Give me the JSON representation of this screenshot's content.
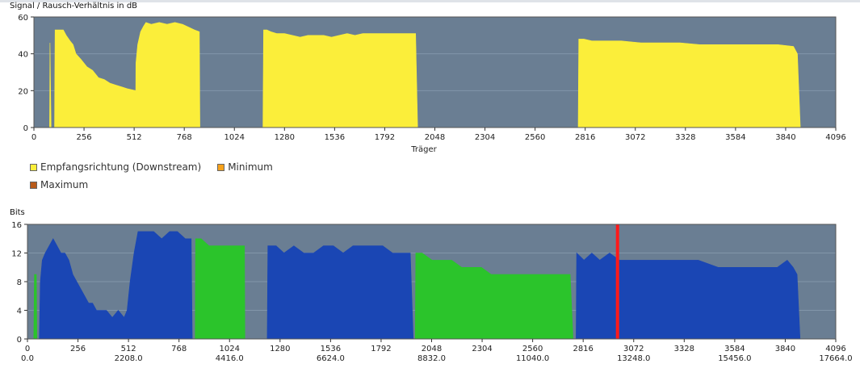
{
  "chart_data": [
    {
      "type": "area",
      "title": "Signal / Rausch-Verhältnis in dB",
      "xlabel": "Träger",
      "ylabel": "",
      "xlim": [
        0,
        4096
      ],
      "ylim": [
        0,
        60
      ],
      "x_ticks": [
        0,
        256,
        512,
        768,
        1024,
        1280,
        1536,
        1792,
        2048,
        2304,
        2560,
        2816,
        3072,
        3328,
        3584,
        3840,
        4096
      ],
      "y_ticks": [
        0,
        20,
        40,
        60
      ],
      "plot_background": "#6a7e93",
      "grid": true,
      "series": [
        {
          "name": "Empfangsrichtung (Downstream)",
          "color": "#fbee3a",
          "points": [
            [
              80,
              0
            ],
            [
              82,
              46
            ],
            [
              88,
              0
            ],
            [
              105,
              0
            ],
            [
              108,
              53
            ],
            [
              150,
              53
            ],
            [
              165,
              50
            ],
            [
              185,
              47
            ],
            [
              200,
              45
            ],
            [
              215,
              40
            ],
            [
              240,
              37
            ],
            [
              270,
              33
            ],
            [
              300,
              31
            ],
            [
              330,
              27
            ],
            [
              360,
              26
            ],
            [
              390,
              24
            ],
            [
              420,
              23
            ],
            [
              450,
              22
            ],
            [
              480,
              21
            ],
            [
              520,
              20
            ],
            [
              521,
              35
            ],
            [
              530,
              45
            ],
            [
              545,
              52
            ],
            [
              560,
              55
            ],
            [
              572,
              57
            ],
            [
              600,
              56
            ],
            [
              640,
              57
            ],
            [
              680,
              56
            ],
            [
              720,
              57
            ],
            [
              760,
              56
            ],
            [
              820,
              53
            ],
            [
              845,
              52
            ],
            [
              848,
              0
            ],
            [
              1170,
              0
            ],
            [
              1173,
              53
            ],
            [
              1190,
              53
            ],
            [
              1210,
              52
            ],
            [
              1240,
              51
            ],
            [
              1280,
              51
            ],
            [
              1320,
              50
            ],
            [
              1360,
              49
            ],
            [
              1400,
              50
            ],
            [
              1440,
              50
            ],
            [
              1480,
              50
            ],
            [
              1520,
              49
            ],
            [
              1560,
              50
            ],
            [
              1600,
              51
            ],
            [
              1640,
              50
            ],
            [
              1680,
              51
            ],
            [
              1720,
              51
            ],
            [
              1760,
              51
            ],
            [
              1800,
              51
            ],
            [
              1850,
              51
            ],
            [
              1900,
              51
            ],
            [
              1950,
              51
            ],
            [
              1960,
              0
            ],
            [
              2780,
              0
            ],
            [
              2783,
              48
            ],
            [
              2810,
              48
            ],
            [
              2850,
              47
            ],
            [
              2900,
              47
            ],
            [
              2950,
              47
            ],
            [
              3000,
              47
            ],
            [
              3100,
              46
            ],
            [
              3200,
              46
            ],
            [
              3300,
              46
            ],
            [
              3400,
              45
            ],
            [
              3500,
              45
            ],
            [
              3600,
              45
            ],
            [
              3700,
              45
            ],
            [
              3800,
              45
            ],
            [
              3880,
              44
            ],
            [
              3900,
              40
            ],
            [
              3915,
              0
            ]
          ]
        },
        {
          "name": "Minimum",
          "color": "#f7a21b",
          "points": []
        },
        {
          "name": "Maximum",
          "color": "#b85a1a",
          "points": []
        }
      ]
    },
    {
      "type": "area",
      "title": "",
      "ylabel": "Bits",
      "xlabel": "",
      "xlim": [
        0,
        4096
      ],
      "ylim": [
        0,
        16
      ],
      "x_ticks": [
        0,
        256,
        512,
        768,
        1024,
        1280,
        1536,
        1792,
        2048,
        2304,
        2560,
        2816,
        3072,
        3328,
        3584,
        3840,
        4096
      ],
      "x_ticks_secondary": [
        "0.0",
        "2208.0",
        "4416.0",
        "6624.0",
        "8832.0",
        "11040.0",
        "13248.0",
        "15456.0",
        "17664.0"
      ],
      "y_ticks": [
        0,
        4,
        8,
        12,
        16
      ],
      "plot_background": "#6a7e93",
      "grid": true,
      "marker_line": {
        "x": 2990,
        "color": "#ff1a1a"
      },
      "series": [
        {
          "name": "",
          "color": "#2bc42b",
          "points": [
            [
              32,
              0
            ],
            [
              35,
              9
            ],
            [
              45,
              9
            ],
            [
              48,
              0
            ]
          ]
        },
        {
          "name": "",
          "color": "#1a46b4",
          "points": [
            [
              60,
              0
            ],
            [
              65,
              8
            ],
            [
              75,
              11
            ],
            [
              90,
              12
            ],
            [
              110,
              13
            ],
            [
              130,
              14
            ],
            [
              150,
              13
            ],
            [
              170,
              12
            ],
            [
              190,
              12
            ],
            [
              210,
              11
            ],
            [
              230,
              9
            ],
            [
              250,
              8
            ],
            [
              270,
              7
            ],
            [
              290,
              6
            ],
            [
              310,
              5
            ],
            [
              330,
              5
            ],
            [
              350,
              4
            ],
            [
              370,
              4
            ],
            [
              400,
              4
            ],
            [
              430,
              3
            ],
            [
              460,
              4
            ],
            [
              490,
              3
            ],
            [
              505,
              4
            ],
            [
              520,
              8
            ],
            [
              540,
              12
            ],
            [
              560,
              15
            ],
            [
              600,
              15
            ],
            [
              640,
              15
            ],
            [
              680,
              14
            ],
            [
              720,
              15
            ],
            [
              760,
              15
            ],
            [
              800,
              14
            ],
            [
              830,
              14
            ],
            [
              835,
              0
            ]
          ]
        },
        {
          "name": "",
          "color": "#2bc42b",
          "points": [
            [
              850,
              0
            ],
            [
              852,
              14
            ],
            [
              880,
              14
            ],
            [
              920,
              13
            ],
            [
              960,
              13
            ],
            [
              1000,
              13
            ],
            [
              1050,
              13
            ],
            [
              1080,
              13
            ],
            [
              1100,
              13
            ],
            [
              1102,
              0
            ]
          ]
        },
        {
          "name": "",
          "color": "#1a46b4",
          "points": [
            [
              1215,
              0
            ],
            [
              1218,
              13
            ],
            [
              1260,
              13
            ],
            [
              1300,
              12
            ],
            [
              1350,
              13
            ],
            [
              1400,
              12
            ],
            [
              1450,
              12
            ],
            [
              1500,
              13
            ],
            [
              1550,
              13
            ],
            [
              1600,
              12
            ],
            [
              1650,
              13
            ],
            [
              1700,
              13
            ],
            [
              1750,
              13
            ],
            [
              1800,
              13
            ],
            [
              1850,
              12
            ],
            [
              1900,
              12
            ],
            [
              1940,
              12
            ],
            [
              1955,
              0
            ]
          ]
        },
        {
          "name": "",
          "color": "#2bc42b",
          "points": [
            [
              1965,
              0
            ],
            [
              1968,
              12
            ],
            [
              2000,
              12
            ],
            [
              2050,
              11
            ],
            [
              2100,
              11
            ],
            [
              2150,
              11
            ],
            [
              2200,
              10
            ],
            [
              2250,
              10
            ],
            [
              2300,
              10
            ],
            [
              2350,
              9
            ],
            [
              2400,
              9
            ],
            [
              2500,
              9
            ],
            [
              2600,
              9
            ],
            [
              2700,
              9
            ],
            [
              2750,
              9
            ],
            [
              2765,
              0
            ]
          ]
        },
        {
          "name": "",
          "color": "#1a46b4",
          "points": [
            [
              2780,
              0
            ],
            [
              2783,
              12
            ],
            [
              2820,
              11
            ],
            [
              2860,
              12
            ],
            [
              2900,
              11
            ],
            [
              2950,
              12
            ],
            [
              3000,
              11
            ],
            [
              3050,
              11
            ],
            [
              3100,
              11
            ],
            [
              3200,
              11
            ],
            [
              3300,
              11
            ],
            [
              3400,
              11
            ],
            [
              3500,
              10
            ],
            [
              3600,
              10
            ],
            [
              3700,
              10
            ],
            [
              3800,
              10
            ],
            [
              3850,
              11
            ],
            [
              3880,
              10
            ],
            [
              3900,
              9
            ],
            [
              3915,
              0
            ]
          ]
        }
      ]
    }
  ]
}
